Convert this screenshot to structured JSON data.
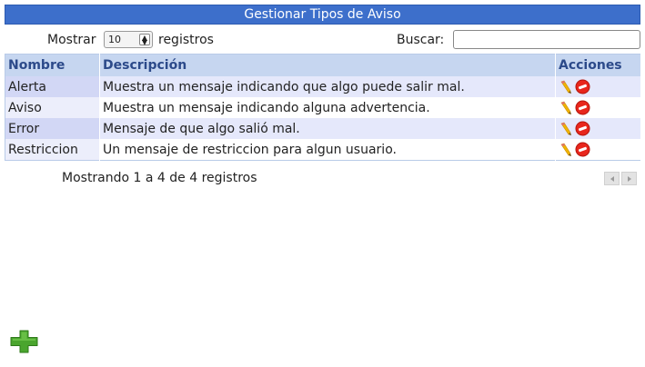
{
  "title": "Gestionar Tipos de Aviso",
  "length": {
    "label": "Mostrar",
    "value": "10",
    "suffix": "registros"
  },
  "search": {
    "label": "Buscar:",
    "value": ""
  },
  "table": {
    "headers": {
      "name": "Nombre",
      "description": "Descripción",
      "actions": "Acciones"
    },
    "rows": [
      {
        "name": "Alerta",
        "description": "Muestra un mensaje indicando que algo puede salir mal."
      },
      {
        "name": "Aviso",
        "description": "Muestra un mensaje indicando alguna advertencia."
      },
      {
        "name": "Error",
        "description": "Mensaje de que algo salió mal."
      },
      {
        "name": "Restriccion",
        "description": "Un mensaje de restriccion para algun usuario."
      }
    ]
  },
  "info": "Mostrando 1 a 4 de 4 registros",
  "icons": {
    "edit": "pencil-icon",
    "delete": "delete-icon",
    "prev": "prev-page-icon",
    "next": "next-page-icon",
    "add": "add-icon"
  },
  "colors": {
    "header_bar": "#3d6fcb",
    "table_header": "#c6d6f0",
    "delete": "#e8261c",
    "add": "#4aa52e"
  }
}
